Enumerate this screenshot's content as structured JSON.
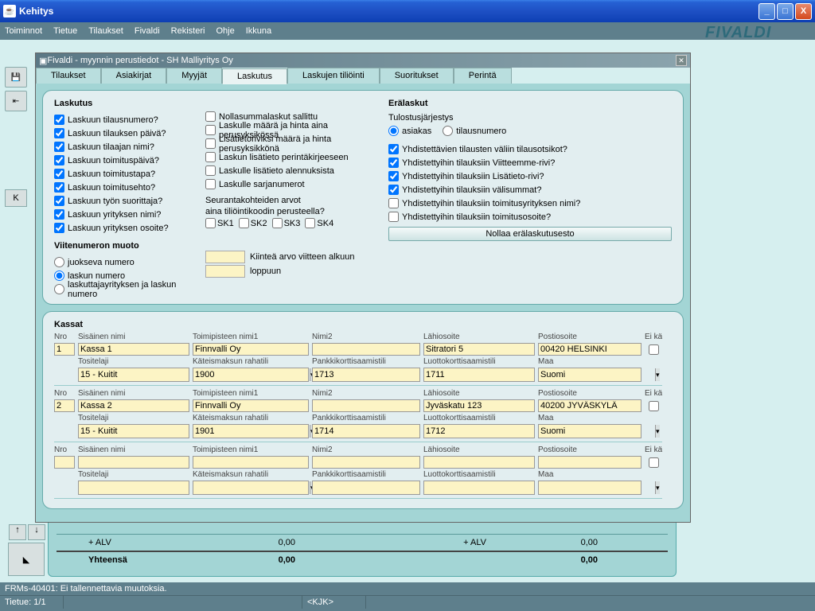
{
  "window": {
    "title": "Kehitys"
  },
  "menu": {
    "items": [
      "Toiminnot",
      "Tietue",
      "Tilaukset",
      "Fivaldi",
      "Rekisteri",
      "Ohje",
      "Ikkuna"
    ]
  },
  "brand": "FIVALDI",
  "k_button": "K",
  "inner": {
    "title": "Fivaldi - myynnin perustiedot - SH Malliyritys Oy"
  },
  "tabs": [
    "Tilaukset",
    "Asiakirjat",
    "Myyjät",
    "Laskutus",
    "Laskujen tiliöinti",
    "Suoritukset",
    "Perintä"
  ],
  "active_tab": "Laskutus",
  "laskutus": {
    "title": "Laskutus",
    "left": [
      {
        "label": "Laskuun tilausnumero?",
        "checked": true
      },
      {
        "label": "Laskuun tilauksen päivä?",
        "checked": true
      },
      {
        "label": "Laskuun tilaajan nimi?",
        "checked": true
      },
      {
        "label": "Laskuun toimituspäivä?",
        "checked": true
      },
      {
        "label": "Laskuun toimitustapa?",
        "checked": true
      },
      {
        "label": "Laskuun toimitusehto?",
        "checked": true
      },
      {
        "label": "Laskuun työn suorittaja?",
        "checked": true
      },
      {
        "label": "Laskuun yrityksen nimi?",
        "checked": true
      },
      {
        "label": "Laskuun yrityksen osoite?",
        "checked": true
      }
    ],
    "mid": [
      {
        "label": "Nollasummalaskut sallittu",
        "checked": false
      },
      {
        "label": "Laskulle määrä ja hinta aina perusyksikössä",
        "checked": false
      },
      {
        "label": "Lisätietoriviksi määrä ja hinta perusyksikkönä",
        "checked": false
      },
      {
        "label": "Laskun lisätieto perintäkirjeeseen",
        "checked": false
      },
      {
        "label": "Laskulle lisätieto alennuksista",
        "checked": false
      },
      {
        "label": "Laskulle sarjanumerot",
        "checked": false
      }
    ],
    "seuranta_label1": "Seurantakohteiden arvot",
    "seuranta_label2": "aina tiliöintikoodin perusteella?",
    "sk": [
      "SK1",
      "SK2",
      "SK3",
      "SK4"
    ]
  },
  "viite": {
    "title": "Viitenumeron muoto",
    "options": [
      "juokseva numero",
      "laskun numero",
      "laskuttajayrityksen ja laskun numero"
    ],
    "selected": 1,
    "kiintea": "Kiinteä arvo viitteen alkuun",
    "loppuun": "loppuun"
  },
  "era": {
    "title": "Erälaskut",
    "tulostus_label": "Tulostusjärjestys",
    "tulostus_opts": [
      "asiakas",
      "tilausnumero"
    ],
    "tulostus_sel": 0,
    "checks": [
      {
        "label": "Yhdistettävien tilausten väliin tilausotsikot?",
        "checked": true
      },
      {
        "label": "Yhdistettyihin tilauksiin Viitteemme-rivi?",
        "checked": true
      },
      {
        "label": "Yhdistettyihin tilauksiin Lisätieto-rivi?",
        "checked": true
      },
      {
        "label": "Yhdistettyihin tilauksiin välisummat?",
        "checked": true
      },
      {
        "label": "Yhdistettyihin tilauksiin toimitusyrityksen nimi?",
        "checked": false
      },
      {
        "label": "Yhdistettyihin tilauksiin toimitusosoite?",
        "checked": false
      }
    ],
    "button": "Nollaa erälaskutusesto"
  },
  "kassat": {
    "title": "Kassat",
    "headers": {
      "nro": "Nro",
      "sisainen": "Sisäinen nimi",
      "toimipiste": "Toimipisteen nimi1",
      "nimi2": "Nimi2",
      "lahiosoite": "Lähiosoite",
      "postiosoite": "Postiosoite",
      "eikayt": "Ei käyt.",
      "tositelaji": "Tositelaji",
      "kateismaksu": "Käteismaksun rahatili",
      "pankki": "Pankkikorttisaamistili",
      "luotto": "Luottokorttisaamistili",
      "maa": "Maa"
    },
    "rows": [
      {
        "nro": "1",
        "sisainen": "Kassa 1",
        "toimipiste": "Finnvalli Oy",
        "nimi2": "",
        "lahi": "Sitratori 5",
        "posti": "00420 HELSINKI",
        "eikayt": false,
        "tositelaji": "15 - Kuitit",
        "kateis": "1900",
        "pankki": "1713",
        "luotto": "1711",
        "maa": "Suomi"
      },
      {
        "nro": "2",
        "sisainen": "Kassa 2",
        "toimipiste": "Finnvalli Oy",
        "nimi2": "",
        "lahi": "Jyväskatu 123",
        "posti": "40200 JYVÄSKYLÄ",
        "eikayt": false,
        "tositelaji": "15 - Kuitit",
        "kateis": "1901",
        "pankki": "1714",
        "luotto": "1712",
        "maa": "Suomi"
      },
      {
        "nro": "",
        "sisainen": "",
        "toimipiste": "",
        "nimi2": "",
        "lahi": "",
        "posti": "",
        "eikayt": false,
        "tositelaji": "",
        "kateis": "",
        "pankki": "",
        "luotto": "",
        "maa": ""
      }
    ]
  },
  "totals": {
    "alv_label": "+ ALV",
    "alv1": "0,00",
    "alv2": "0,00",
    "yhteensa_label": "Yhteensä",
    "yht1": "0,00",
    "yht2": "0,00"
  },
  "status": {
    "msg": "FRMs-40401: Ei tallennettavia muutoksia.",
    "record": "Tietue: 1/1",
    "user": "<KJK>"
  }
}
